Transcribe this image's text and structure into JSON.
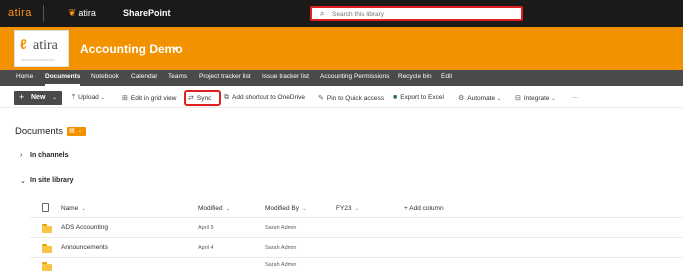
{
  "topbar": {
    "brand_text": "atira",
    "app_logo_text": "atira",
    "product": "SharePoint",
    "search_placeholder": "Search this library"
  },
  "site": {
    "logo_text": "atira",
    "title": "Accounting Demo"
  },
  "nav": {
    "items": [
      "Home",
      "Documents",
      "Notebook",
      "Calendar",
      "Teams",
      "Project tracker list",
      "Issue tracker list",
      "Accounting Permissions",
      "Recycle bin",
      "Edit"
    ],
    "active": "Documents"
  },
  "commands": {
    "new": "New",
    "upload": "Upload",
    "edit_grid": "Edit in grid view",
    "sync": "Sync",
    "shortcut": "Add shortcut to OneDrive",
    "pin": "Pin to Quick access",
    "export": "Export to Excel",
    "automate": "Automate",
    "integrate": "Integrate",
    "more": "···"
  },
  "library": {
    "title": "Documents",
    "groups": [
      "In channels",
      "In site library"
    ]
  },
  "columns": {
    "name": "Name",
    "modified": "Modified",
    "modified_by": "Modified By",
    "fy": "FY23",
    "add": "+ Add column"
  },
  "rows": [
    {
      "name": "ADS Accounting",
      "modified": "April 5",
      "modified_by": "Sarah Admin"
    },
    {
      "name": "Announcements",
      "modified": "April 4",
      "modified_by": "Sarah Admin"
    },
    {
      "name": "",
      "modified": "",
      "modified_by": "Sarah Admin"
    }
  ],
  "colors": {
    "brand_orange": "#f39200",
    "suite_bar": "#1b1a19",
    "nav_bar": "#4a4a4a",
    "highlight_red": "#e02020"
  },
  "icons": [
    "waffle-icon",
    "search-icon",
    "speaker-icon",
    "upload-icon",
    "grid-edit-icon",
    "sync-icon",
    "shortcut-icon",
    "pin-icon",
    "excel-icon",
    "automate-icon",
    "integrate-icon",
    "view-library-icon",
    "chevron-right-icon",
    "chevron-down-icon",
    "file-icon",
    "folder-icon"
  ]
}
